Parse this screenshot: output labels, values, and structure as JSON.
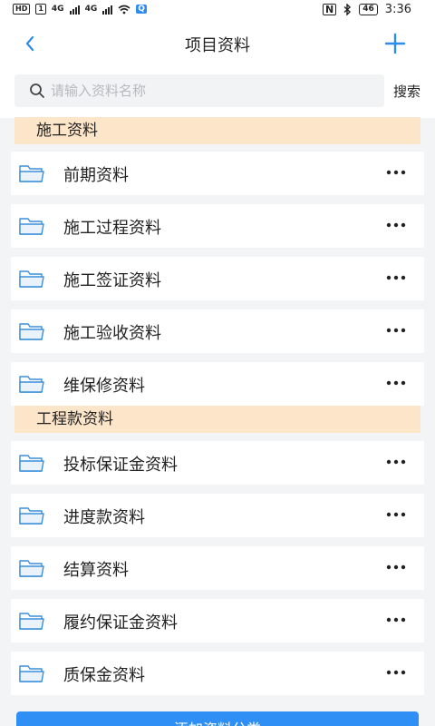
{
  "status_bar": {
    "left_badges": [
      "HD",
      "1"
    ],
    "signal_1": "4G",
    "signal_2": "4G",
    "app_badge": "Q",
    "nfc": "N",
    "battery": "46",
    "time": "3:36"
  },
  "header": {
    "title": "项目资料",
    "back_icon": "chevron-left-icon",
    "add_icon": "plus-icon",
    "accent_color": "#2d8cf0"
  },
  "search": {
    "placeholder": "请输入资料名称",
    "value": "",
    "button_label": "搜索"
  },
  "sections": [
    {
      "title": "施工资料",
      "items": [
        {
          "label": "前期资料"
        },
        {
          "label": "施工过程资料"
        },
        {
          "label": "施工签证资料"
        },
        {
          "label": "施工验收资料"
        },
        {
          "label": "维保修资料"
        }
      ]
    },
    {
      "title": "工程款资料",
      "items": [
        {
          "label": "投标保证金资料"
        },
        {
          "label": "进度款资料"
        },
        {
          "label": "结算资料"
        },
        {
          "label": "履约保证金资料"
        },
        {
          "label": "质保金资料"
        }
      ]
    }
  ],
  "footer": {
    "button_label": "添加资料分类"
  },
  "colors": {
    "section_bg": "#fde5c9",
    "folder_icon": "#3b8fd9",
    "primary_button": "#2f8ff5"
  }
}
